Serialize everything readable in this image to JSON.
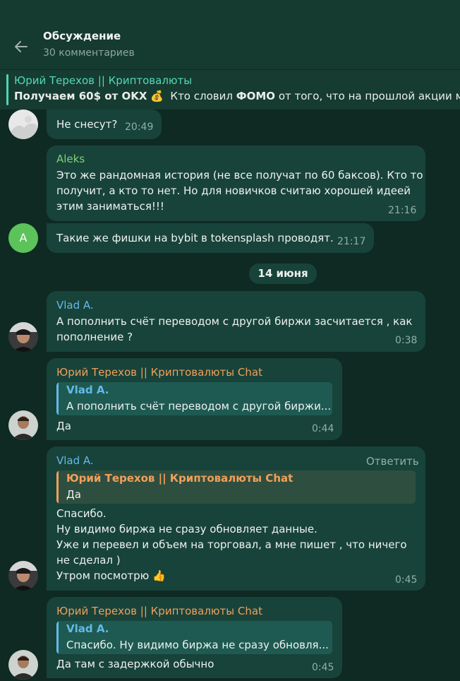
{
  "header": {
    "title": "Обсуждение",
    "subtitle": "30 комментариев"
  },
  "pinned": {
    "title": "Юрий Терехов || Криптовалюты",
    "text_bold": "Получаем 60$ от OKX",
    "emoji": "💰",
    "text_mid": "Кто словил",
    "text_bold2": "ФОМО",
    "text_rest": "от того, что на прошлой акции мы з"
  },
  "date_separator": "14 июня",
  "messages": [
    {
      "text": "Не снесут?",
      "time": "20:49"
    },
    {
      "author": "Aleks",
      "text": "Это же рандомная история (не все получат по 60 баксов). Кто то\nполучит, а кто то нет. Но для новичков считаю хорошей идеей\nэтим заниматься!!!",
      "time": "21:16"
    },
    {
      "avatar_letter": "A",
      "text": "Такие же фишки на bybit в tokensplash проводят.",
      "time": "21:17"
    },
    {
      "author": "Vlad A.",
      "text": "А пополнить счёт переводом с другой биржи засчитается , как\nпополнение ?",
      "time": "0:38"
    },
    {
      "author": "Юрий Терехов || Криптовалюты Chat",
      "reply_name": "Vlad A.",
      "reply_text": "А пополнить счёт переводом с другой биржи...",
      "text": "Да",
      "time": "0:44"
    },
    {
      "author": "Vlad A.",
      "action": "Ответить",
      "reply_name": "Юрий Терехов || Криптовалюты Chat",
      "reply_text": "Да",
      "text": "Спасибо.\nНу видимо биржа не сразу обновляет данные.\nУже и перевел и объем на торговал, а мне пишет , что ничего\nне сделал )\nУтром посмотрю 👍",
      "time": "0:45"
    },
    {
      "author": "Юрий Терехов || Криптовалюты Chat",
      "reply_name": "Vlad A.",
      "reply_text": "Спасибо. Ну видимо биржа не сразу обновля...",
      "text": "Да там с задержкой обычно",
      "time": "0:45"
    }
  ],
  "colors": {
    "background": "#0e2a22",
    "bubble": "#18433a",
    "accent_teal": "#4fd6b6",
    "name_green": "#7fd17a",
    "name_blue": "#64b9e8",
    "name_orange": "#f0a05a",
    "avatar_green": "#5cc35a"
  }
}
